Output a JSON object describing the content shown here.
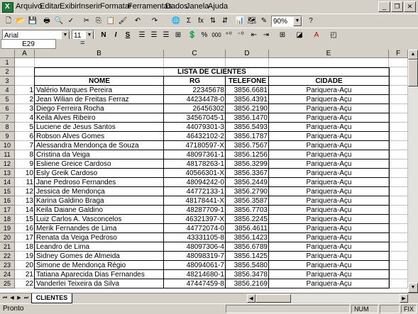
{
  "menu": [
    "Arquivo",
    "Editar",
    "Exibir",
    "Inserir",
    "Formatar",
    "Ferramentas",
    "Dados",
    "Janela",
    "Ajuda"
  ],
  "toolbar": {
    "zoom": "90%",
    "font_name": "Arial",
    "font_size": "11",
    "bold": "N",
    "italic": "I",
    "underline": "S",
    "percent": "%",
    "thousands": "000",
    "sum": "Σ",
    "fx": "fx",
    "help": "?"
  },
  "formula_bar": {
    "name_box": "E29",
    "equals": "=",
    "value": ""
  },
  "columns": [
    "A",
    "B",
    "C",
    "D",
    "E",
    "F"
  ],
  "sheet": {
    "title": "LISTA DE CLIENTES",
    "headers": [
      "NOME",
      "RG",
      "TELEFONE",
      "CIDADE"
    ],
    "rows": [
      {
        "n": "1",
        "nome": "Valério Marques Pereira",
        "rg": "22345678",
        "tel": "3856.6681",
        "cidade": "Pariquera-Açu"
      },
      {
        "n": "2",
        "nome": "Jean Wilian de Freitas Ferraz",
        "rg": "44234478-0",
        "tel": "3856.4391",
        "cidade": "Pariquera-Açu"
      },
      {
        "n": "3",
        "nome": "Diego Ferreira Rocha",
        "rg": "26456302",
        "tel": "3856.2190",
        "cidade": "Pariquera-Açu"
      },
      {
        "n": "4",
        "nome": "Keila Alves Ribeiro",
        "rg": "34567045-1",
        "tel": "3856.1470",
        "cidade": "Pariquera-Açu"
      },
      {
        "n": "5",
        "nome": "Luciene de Jesus Santos",
        "rg": "44079301-3",
        "tel": "3856.5493",
        "cidade": "Pariquera-Açu"
      },
      {
        "n": "6",
        "nome": "Robson Alves Gomes",
        "rg": "46432102-2",
        "tel": "3856.1787",
        "cidade": "Pariquera-Açu"
      },
      {
        "n": "7",
        "nome": "Alessandra Mendonça de Souza",
        "rg": "47180597-X",
        "tel": "3856.7567",
        "cidade": "Pariquera-Açu"
      },
      {
        "n": "8",
        "nome": "Cristina da Veiga",
        "rg": "48097361-1",
        "tel": "3856.1256",
        "cidade": "Pariquera-Açu"
      },
      {
        "n": "9",
        "nome": "Esliene Greice Cardoso",
        "rg": "48178263-1",
        "tel": "3856.3299",
        "cidade": "Pariquera-Açu"
      },
      {
        "n": "10",
        "nome": "Esly Greik Cardoso",
        "rg": "40566301-X",
        "tel": "3856.3367",
        "cidade": "Pariquera-Açu"
      },
      {
        "n": "11",
        "nome": "Jane Pedroso Fernandes",
        "rg": "48094242-0",
        "tel": "3856.2449",
        "cidade": "Pariquera-Açu"
      },
      {
        "n": "12",
        "nome": "Jessica de Mendonça",
        "rg": "44772133-1",
        "tel": "3856.2790",
        "cidade": "Pariquera-Açu"
      },
      {
        "n": "13",
        "nome": "Karina Galdino Braga",
        "rg": "48178441-X",
        "tel": "3856.3587",
        "cidade": "Pariquera-Açu"
      },
      {
        "n": "14",
        "nome": "Keila Daiane Galdino",
        "rg": "48287709-1",
        "tel": "3856.7703",
        "cidade": "Pariquera-Açu"
      },
      {
        "n": "15",
        "nome": "Luiz Carlos A. Vasconcelos",
        "rg": "46321397-X",
        "tel": "3856.2245",
        "cidade": "Pariquera-Açu"
      },
      {
        "n": "16",
        "nome": "Merik Fernandes de Lima",
        "rg": "44772074-0",
        "tel": "3856.4611",
        "cidade": "Pariquera-Açu"
      },
      {
        "n": "17",
        "nome": "Renata da Veiga Pedroso",
        "rg": "43331105-8",
        "tel": "3856.1423",
        "cidade": "Pariquera-Açu"
      },
      {
        "n": "18",
        "nome": "Leandro de Lima",
        "rg": "48097306-4",
        "tel": "3856.6789",
        "cidade": "Pariquera-Açu"
      },
      {
        "n": "19",
        "nome": "Sidney Gomes de Almeida",
        "rg": "48098319-7",
        "tel": "3856.1425",
        "cidade": "Pariquera-Açu"
      },
      {
        "n": "20",
        "nome": "Simone de Mendonça Régio",
        "rg": "48094061-7",
        "tel": "3856.5480",
        "cidade": "Pariquera-Açu"
      },
      {
        "n": "21",
        "nome": "Tatiana Aparecida Dias Fernandes",
        "rg": "48214680-1",
        "tel": "3856.3478",
        "cidade": "Pariquera-Açu"
      },
      {
        "n": "22",
        "nome": "Vanderlei Teixeira da Silva",
        "rg": "47447459-8",
        "tel": "3856.2169",
        "cidade": "Pariquera-Açu"
      }
    ]
  },
  "tabs": [
    "CLIENTES"
  ],
  "status": {
    "text": "Pronto",
    "num": "NUM",
    "fix": "FIX"
  }
}
